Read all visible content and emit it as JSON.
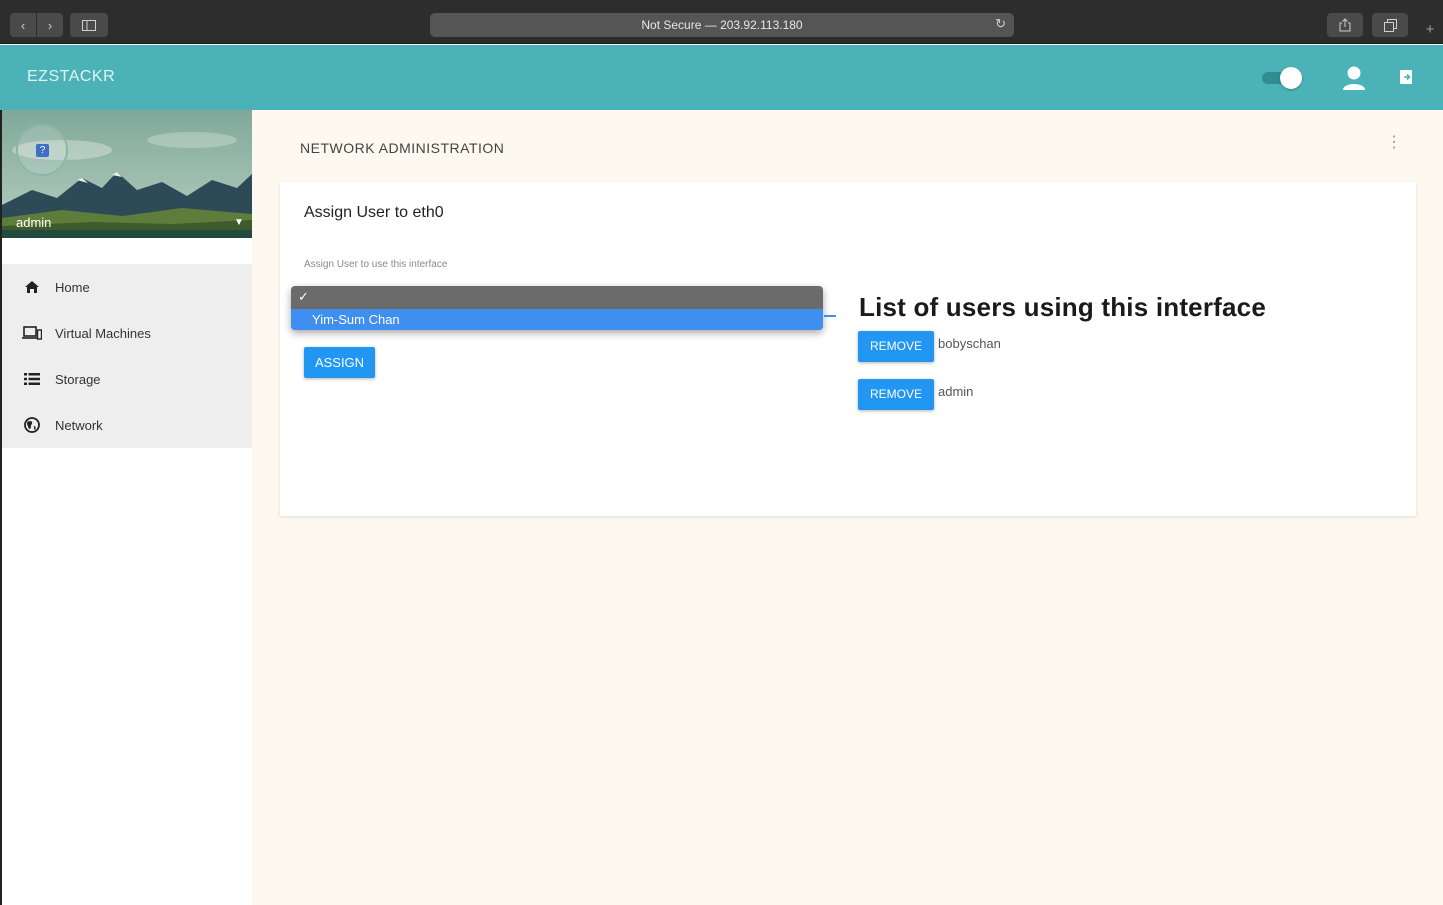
{
  "browser": {
    "address": "Not Secure — 203.92.113.180"
  },
  "header": {
    "brand": "EZSTACKR"
  },
  "sidebar": {
    "profile_name": "admin",
    "items": [
      {
        "label": "Home",
        "icon": "home-icon"
      },
      {
        "label": "Virtual Machines",
        "icon": "laptop-icon"
      },
      {
        "label": "Storage",
        "icon": "list-icon"
      },
      {
        "label": "Network",
        "icon": "globe-icon"
      }
    ]
  },
  "main": {
    "title": "NETWORK ADMINISTRATION",
    "card": {
      "title": "Assign User to eth0",
      "field_label": "Assign User to use this interface",
      "dropdown": {
        "check": "✓",
        "selected_option": "Yim-Sum Chan"
      },
      "assign_label": "ASSIGN",
      "list_title": "List of users using this interface",
      "users": [
        {
          "remove_label": "REMOVE",
          "name": "bobyschan"
        },
        {
          "remove_label": "REMOVE",
          "name": "admin"
        }
      ]
    }
  },
  "colors": {
    "header": "#4bb2b8",
    "primary_button": "#2196f3",
    "main_background": "#fdf9f0"
  }
}
